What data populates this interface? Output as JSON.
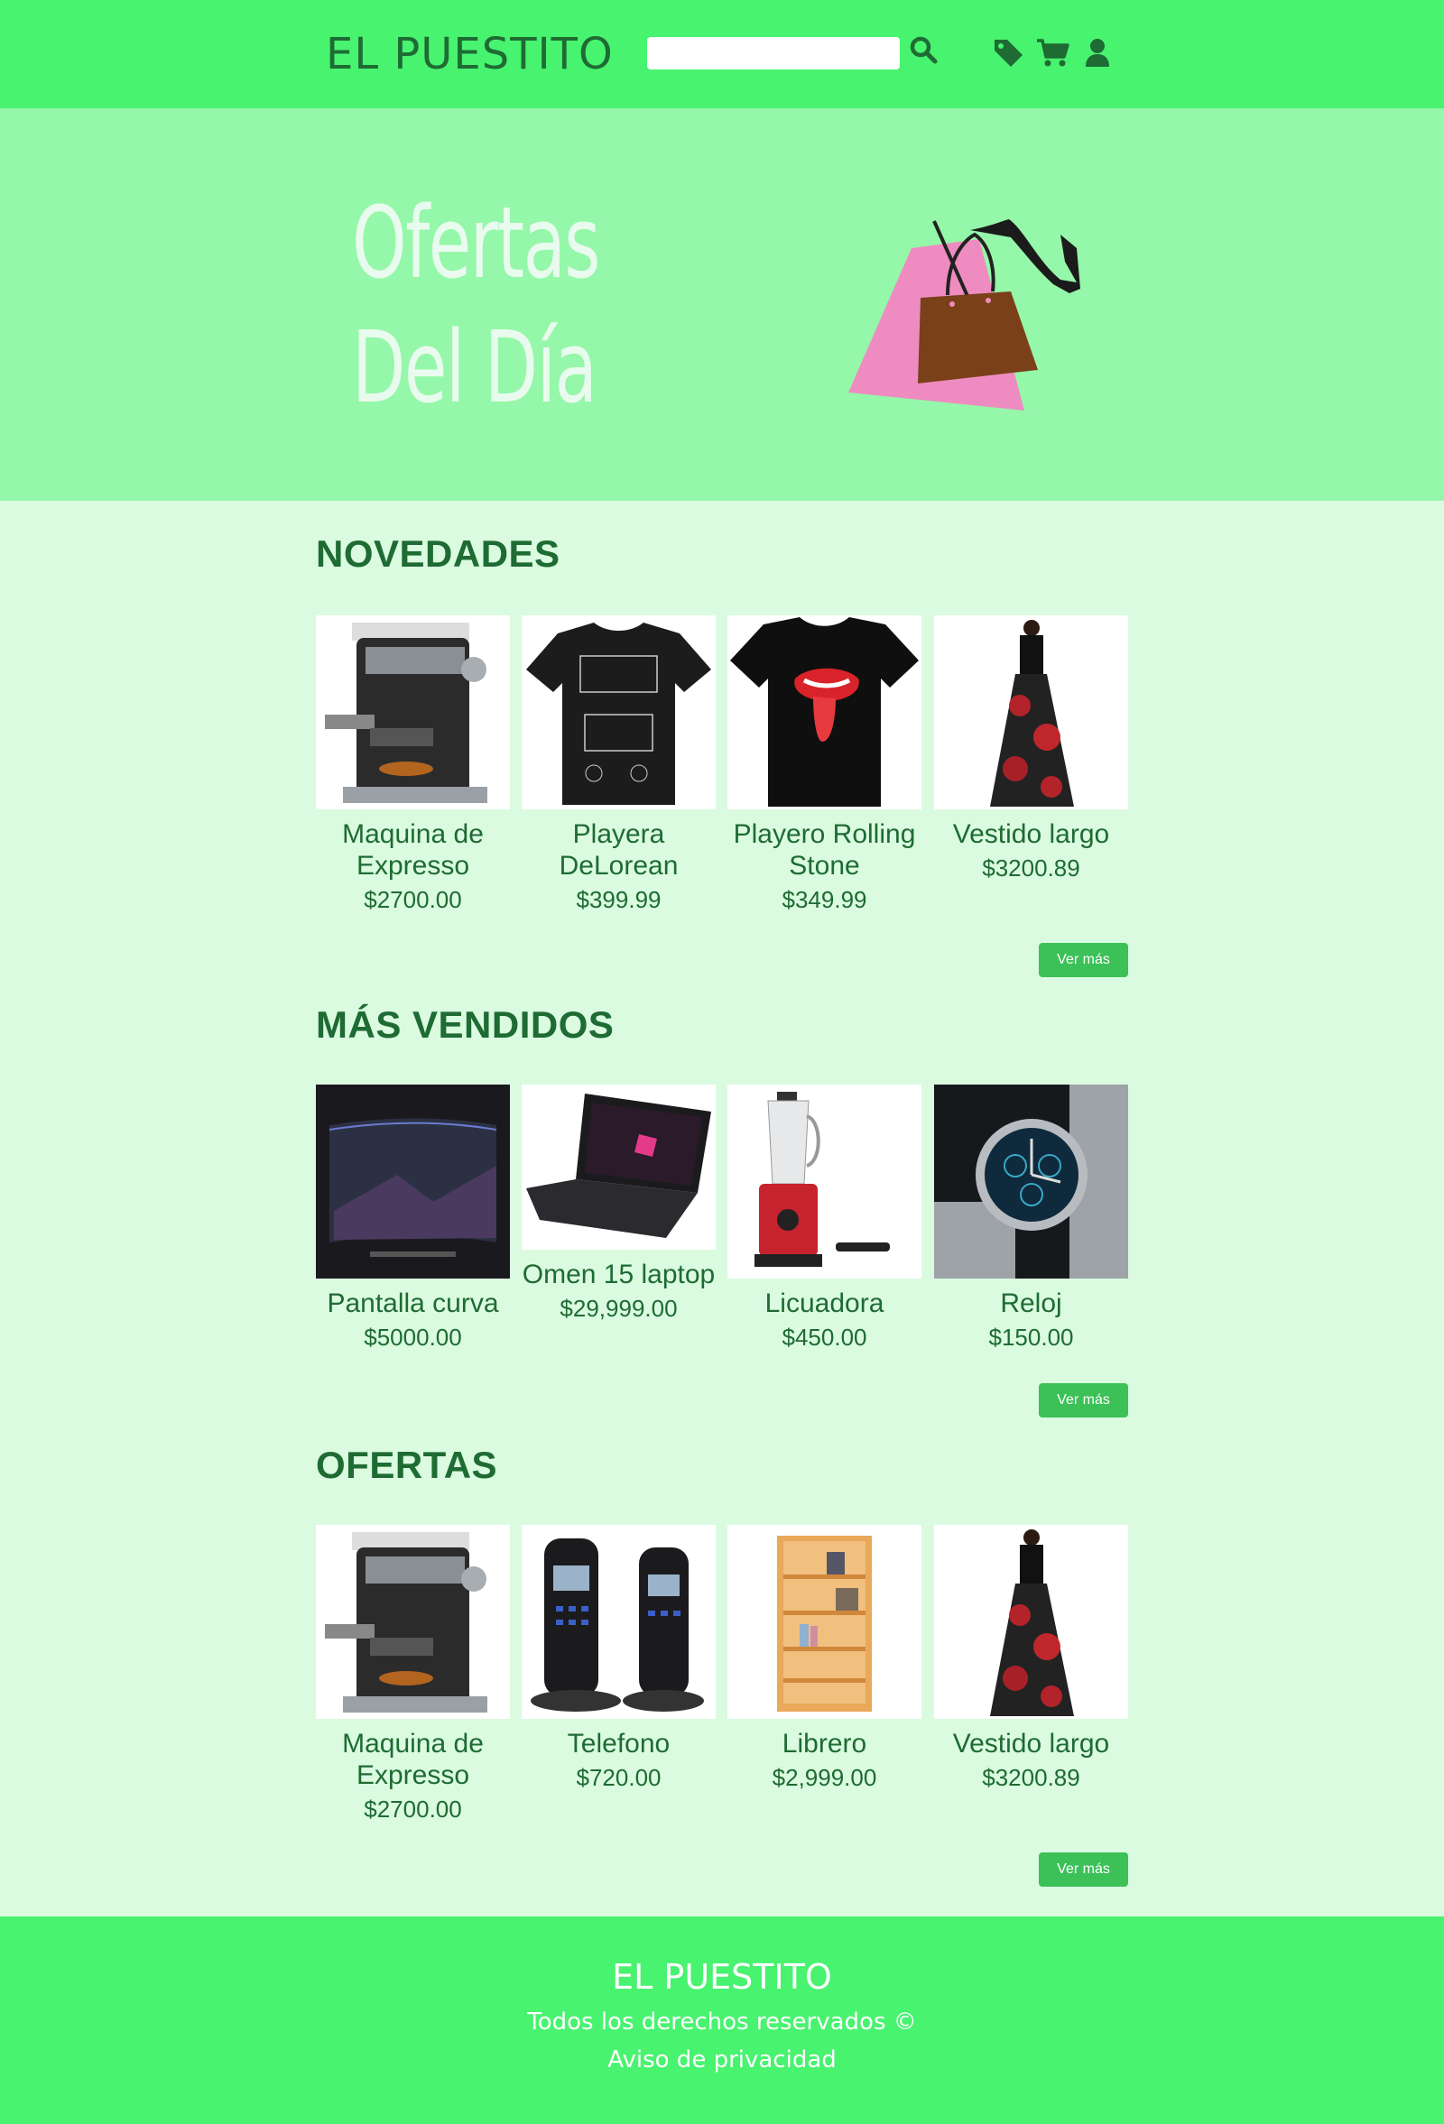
{
  "header": {
    "logo": "EL PUESTITO",
    "search": {
      "value": "",
      "placeholder": ""
    },
    "icons": [
      "search-icon",
      "tag-icon",
      "cart-icon",
      "user-icon"
    ],
    "colors": {
      "bar": "#48f36f",
      "text": "#1e6b33"
    }
  },
  "hero": {
    "line1": "Ofertas",
    "line2": "Del Día",
    "colors": {
      "background": "#95f7a9",
      "text": "#e9fbee"
    }
  },
  "sections": {
    "novedades": {
      "title": "NOVEDADES",
      "more_label": "Ver más",
      "products": [
        {
          "name": "Maquina de Expresso",
          "price": "$2700.00",
          "image": "espresso-machine"
        },
        {
          "name": "Playera DeLorean",
          "price": "$399.99",
          "image": "delorean-tshirt"
        },
        {
          "name": "Playero Rolling Stone",
          "price": "$349.99",
          "image": "rolling-stones-tshirt"
        },
        {
          "name": "Vestido largo",
          "price": "$3200.89",
          "image": "long-dress"
        }
      ]
    },
    "mas_vendidos": {
      "title": "MÁS VENDIDOS",
      "more_label": "Ver más",
      "products": [
        {
          "name": "Pantalla curva",
          "price": "$5000.00",
          "image": "curved-tv"
        },
        {
          "name": "Omen 15 laptop",
          "price": "$29,999.00",
          "image": "laptop"
        },
        {
          "name": "Licuadora",
          "price": "$450.00",
          "image": "blender"
        },
        {
          "name": "Reloj",
          "price": "$150.00",
          "image": "wrist-watch"
        }
      ]
    },
    "ofertas": {
      "title": "OFERTAS",
      "more_label": "Ver más",
      "products": [
        {
          "name": "Maquina de Expresso",
          "price": "$2700.00",
          "image": "espresso-machine"
        },
        {
          "name": "Telefono",
          "price": "$720.00",
          "image": "cordless-phone"
        },
        {
          "name": "Librero",
          "price": "$2,999.00",
          "image": "bookshelf"
        },
        {
          "name": "Vestido largo",
          "price": "$3200.89",
          "image": "long-dress"
        }
      ]
    }
  },
  "footer": {
    "title": "EL PUESTITO",
    "rights": "Todos los derechos reservados ©",
    "privacy": "Aviso de privacidad"
  }
}
